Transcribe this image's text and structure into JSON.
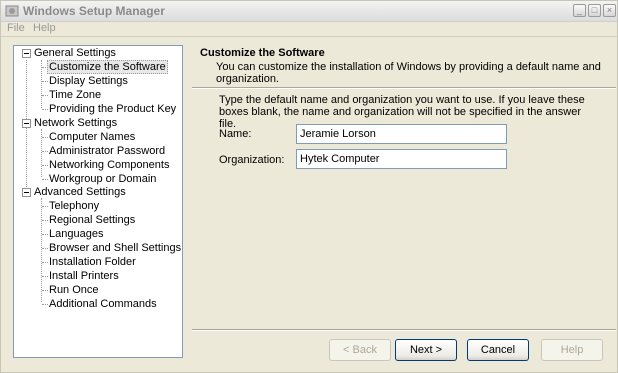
{
  "window": {
    "title": "Windows Setup Manager"
  },
  "menu": [
    "File",
    "Help"
  ],
  "title_buttons": {
    "minimize": "_",
    "maximize": "□",
    "close": "×"
  },
  "tree": {
    "groups": [
      {
        "label": "General Settings",
        "items": [
          "Customize the Software",
          "Display Settings",
          "Time Zone",
          "Providing the Product Key"
        ]
      },
      {
        "label": "Network Settings",
        "items": [
          "Computer Names",
          "Administrator Password",
          "Networking Components",
          "Workgroup or Domain"
        ]
      },
      {
        "label": "Advanced Settings",
        "items": [
          "Telephony",
          "Regional Settings",
          "Languages",
          "Browser and Shell Settings",
          "Installation Folder",
          "Install Printers",
          "Run Once",
          "Additional Commands"
        ]
      }
    ],
    "selected": "Customize the Software"
  },
  "page": {
    "title": "Customize the Software",
    "description": "You can customize the installation of Windows by providing a default name and organization.",
    "instructions": "Type the default name and organization you want to use. If you leave these boxes blank, the name and organization will not be specified in the answer file.",
    "name_label": "Name:",
    "name_value": "Jeramie Lorson",
    "org_label": "Organization:",
    "org_value": "Hytek Computer"
  },
  "buttons": {
    "back": "< Back",
    "next": "Next >",
    "cancel": "Cancel",
    "help": "Help"
  }
}
